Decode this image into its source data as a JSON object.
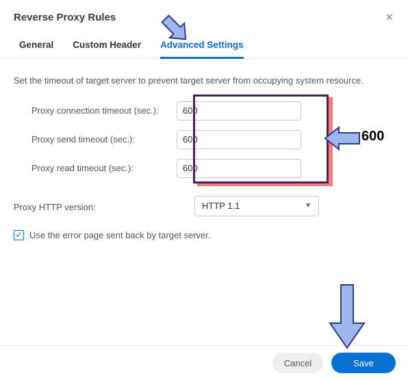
{
  "dialog": {
    "title": "Reverse Proxy Rules",
    "close_label": "×"
  },
  "tabs": {
    "general": "General",
    "custom_header": "Custom Header",
    "advanced": "Advanced Settings"
  },
  "description": "Set the timeout of target server to prevent target server from occupying system resource.",
  "fields": {
    "conn_timeout_label": "Proxy connection timeout (sec.):",
    "conn_timeout_value": "600",
    "send_timeout_label": "Proxy send timeout (sec.):",
    "send_timeout_value": "600",
    "read_timeout_label": "Proxy read timeout (sec.):",
    "read_timeout_value": "600",
    "http_version_label": "Proxy HTTP version:",
    "http_version_value": "HTTP 1.1",
    "error_page_label": "Use the error page sent back by target server.",
    "error_page_checked": true
  },
  "buttons": {
    "cancel": "Cancel",
    "save": "Save"
  },
  "annotation": {
    "value_hint": "600"
  },
  "colors": {
    "accent": "#0a6ed1",
    "arrow_fill": "#9fb7ea",
    "arrow_stroke": "#2b3b8f",
    "highlight_border": "#47215a",
    "highlight_shadow": "#fb7d7d"
  }
}
